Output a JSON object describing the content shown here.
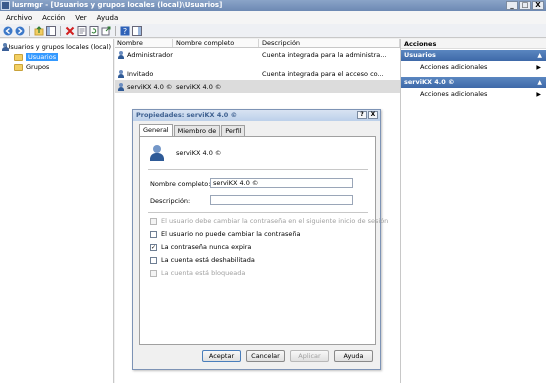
{
  "window": {
    "title": "lusrmgr - [Usuarios y grupos locales (local)\\Usuarios]",
    "min_label": "_",
    "max_label": "□",
    "close_label": "X"
  },
  "menu": [
    "Archivo",
    "Acción",
    "Ver",
    "Ayuda"
  ],
  "toolbar": {
    "icons": [
      "back-arrow-icon",
      "forward-arrow-icon",
      "up-folder-icon",
      "show-hide-tree-icon",
      "delete-icon",
      "properties-icon",
      "refresh-icon",
      "export-icon",
      "help-icon",
      "show-hide-action-icon"
    ]
  },
  "tree": {
    "root": "Usuarios y grupos locales (local)",
    "children": [
      "Usuarios",
      "Grupos"
    ]
  },
  "list": {
    "columns": [
      "Nombre",
      "Nombre completo",
      "Descripción"
    ],
    "rows": [
      {
        "name": "Administrador",
        "full_name": "",
        "description": "Cuenta integrada para la administra..."
      },
      {
        "name": "Invitado",
        "full_name": "",
        "description": "Cuenta integrada para el acceso co..."
      },
      {
        "name": "serviKX 4.0 ©",
        "full_name": "serviKX 4.0 ©",
        "description": ""
      }
    ]
  },
  "actions": {
    "title": "Acciones",
    "groups": [
      {
        "header": "Usuarios",
        "items": [
          "Acciones adicionales"
        ]
      },
      {
        "header": "serviKX 4.0 ©",
        "items": [
          "Acciones adicionales"
        ]
      }
    ]
  },
  "dialog": {
    "title": "Propiedades: serviKX 4.0 ©",
    "help_label": "?",
    "close_label": "X",
    "tabs": [
      "General",
      "Miembro de",
      "Perfil"
    ],
    "user_name": "serviKX 4.0 ©",
    "full_name_label": "Nombre completo:",
    "full_name_value": "serviKX 4.0 ©",
    "description_label": "Descripción:",
    "description_value": "",
    "checkboxes": [
      {
        "label": "El usuario debe cambiar la contraseña en el siguiente inicio de sesión",
        "checked": false,
        "enabled": false
      },
      {
        "label": "El usuario no puede cambiar la contraseña",
        "checked": false,
        "enabled": true
      },
      {
        "label": "La contraseña nunca expira",
        "checked": true,
        "enabled": true
      },
      {
        "label": "La cuenta está deshabilitada",
        "checked": false,
        "enabled": true
      },
      {
        "label": "La cuenta está bloqueada",
        "checked": false,
        "enabled": false
      }
    ],
    "buttons": {
      "ok": "Aceptar",
      "cancel": "Cancelar",
      "apply": "Aplicar",
      "help": "Ayuda"
    }
  }
}
